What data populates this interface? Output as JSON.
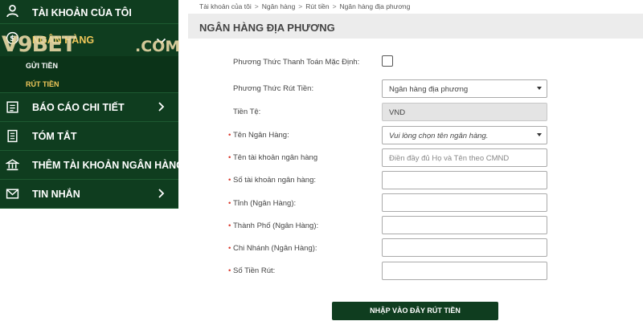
{
  "sidebar": {
    "account_label": "TÀI KHOẢN CỦA TÔI",
    "bank_label": "NGÂN HÀNG",
    "sub_items": [
      "GỬI TIỀN",
      "RÚT TIỀN"
    ],
    "report_label": "BÁO CÁO CHI TIẾT",
    "summary_label": "TÓM TẮT",
    "add_bank_label": "THÊM TÀI KHOẢN NGÂN HÀNG",
    "messages_label": "TIN NHẮN"
  },
  "logo": {
    "name": "V9BET",
    "suffix": ".COM"
  },
  "breadcrumb": [
    "Tài khoản của tôi",
    "Ngân hàng",
    "Rút tiền",
    "Ngân hàng địa phương"
  ],
  "breadcrumb_separator": ">",
  "page_title": "NGÂN HÀNG ĐỊA PHƯƠNG",
  "form": {
    "default_method_label": "Phương Thức Thanh Toán Mặc Định:",
    "default_method_checked": false,
    "withdraw_method_label": "Phương Thức Rút Tiền:",
    "withdraw_method_value": "Ngân hàng địa phương",
    "currency_label": "Tiền Tệ:",
    "currency_value": "VND",
    "bank_name_label": "Tên Ngân Hàng:",
    "bank_name_value": "Vui lòng chọn tên ngân hàng.",
    "account_name_label": "Tên tài khoản ngân hàng",
    "account_name_placeholder": "Điền đầy đủ Họ và Tên theo CMND",
    "account_number_label": "Số tài khoản ngân hàng:",
    "province_label": "Tỉnh (Ngân Hàng):",
    "city_label": "Thành Phố (Ngân Hàng):",
    "branch_label": "Chi Nhánh (Ngân Hàng):",
    "amount_label": "Số Tiền Rút:",
    "required_mark": "•"
  },
  "submit_label": "NHẬP VÀO ĐÂY RÚT TIỀN",
  "colors": {
    "sidebar_bg": "#0f3d1f",
    "accent_gold": "#f1c85a",
    "required": "#d9382b"
  }
}
